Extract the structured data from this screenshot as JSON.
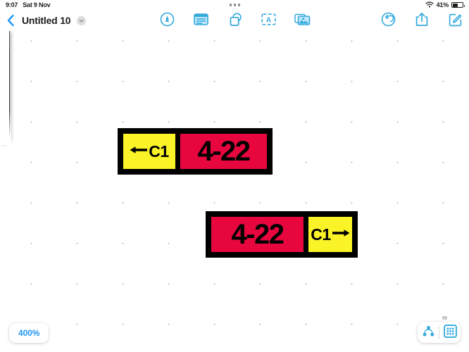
{
  "status_bar": {
    "time": "9:07",
    "date": "Sat 9 Nov",
    "battery_percent": "41%",
    "wifi_icon": "wifi-icon",
    "battery_icon": "battery-icon",
    "dynamic_island_icon": "status-dots-indicator"
  },
  "navbar": {
    "back_icon": "back-chevron-icon",
    "title": "Untitled 10",
    "title_disclosure_icon": "chevron-down-icon",
    "tools": [
      {
        "name": "pen-tool-button",
        "icon": "pen-in-circle-icon",
        "label": "Pen"
      },
      {
        "name": "note-tool-button",
        "icon": "sticky-note-icon",
        "label": "Note"
      },
      {
        "name": "shape-tool-button",
        "icon": "overlapping-shapes-icon",
        "label": "Shape"
      },
      {
        "name": "text-tool-button",
        "icon": "text-box-a-icon",
        "label": "Text"
      },
      {
        "name": "media-tool-button",
        "icon": "photos-stack-icon",
        "label": "Media"
      }
    ],
    "actions": [
      {
        "name": "undo-button",
        "icon": "undo-circular-arrow-icon",
        "label": "Undo"
      },
      {
        "name": "share-button",
        "icon": "share-up-arrow-icon",
        "label": "Share"
      },
      {
        "name": "compose-button",
        "icon": "compose-pencil-square-icon",
        "label": "Compose"
      }
    ]
  },
  "canvas": {
    "background_color": "#ffffff",
    "grid": "dotted",
    "grid_dot_color": "#c9c9cd",
    "stickers": [
      {
        "id": "sticker-1",
        "border_color": "#000000",
        "cells": [
          {
            "fill": "#f9f327",
            "text": "C1",
            "arrow": "left",
            "arrow_position": "before"
          },
          {
            "fill": "#e8063f",
            "text": "4-22",
            "arrow": "none"
          }
        ]
      },
      {
        "id": "sticker-2",
        "border_color": "#000000",
        "cells": [
          {
            "fill": "#e8063f",
            "text": "4-22",
            "arrow": "none"
          },
          {
            "fill": "#f9f327",
            "text": "C1",
            "arrow": "right",
            "arrow_position": "after"
          }
        ]
      }
    ]
  },
  "bottom_bar": {
    "zoom_level": "400%",
    "view_buttons": [
      {
        "name": "outline-view-button",
        "icon": "node-hierarchy-icon",
        "active": false
      },
      {
        "name": "grid-view-button",
        "icon": "grid-squares-icon",
        "active": true
      }
    ]
  },
  "colors": {
    "accent": "#2196f3",
    "tool_blue": "#34aadc",
    "crimson": "#e8063f",
    "yellow": "#f9f327",
    "black": "#000000"
  }
}
